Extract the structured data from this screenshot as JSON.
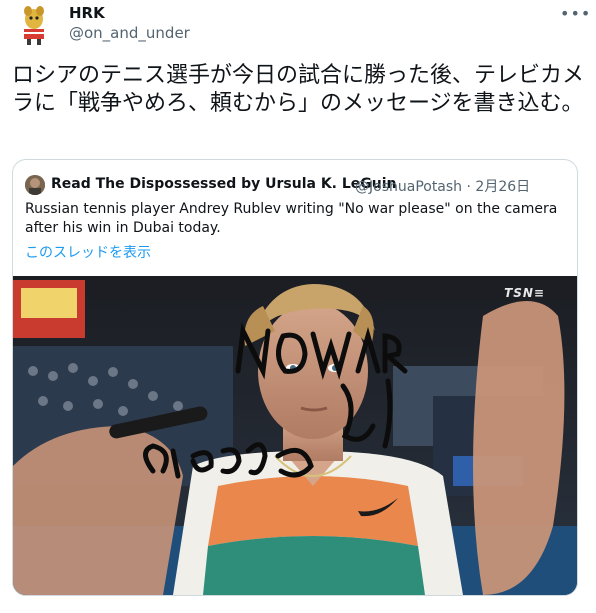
{
  "tweet": {
    "author_name": "HRK",
    "author_handle": "@on_and_under",
    "more_glyph": "•••",
    "text": "ロシアのテニス選手が今日の試合に勝った後、テレビカメラに「戦争やめろ、頼むから」のメッセージを書き込む。"
  },
  "quoted": {
    "author_name": "Read The Dispossessed by Ursula K. LeGuin",
    "author_handle": "@JoshuaPotash · 2月26日",
    "text": "Russian tennis player Andrey Rublev writing \"No war please\" on the camera after his win in Dubai today.",
    "thread_link": "このスレッドを表示",
    "media_watermark": "TSN≡",
    "handwritten": "NO WAR PLEASE"
  },
  "colors": {
    "link": "#1d9bf0",
    "secondary": "#536471",
    "border": "#cfd9de"
  }
}
